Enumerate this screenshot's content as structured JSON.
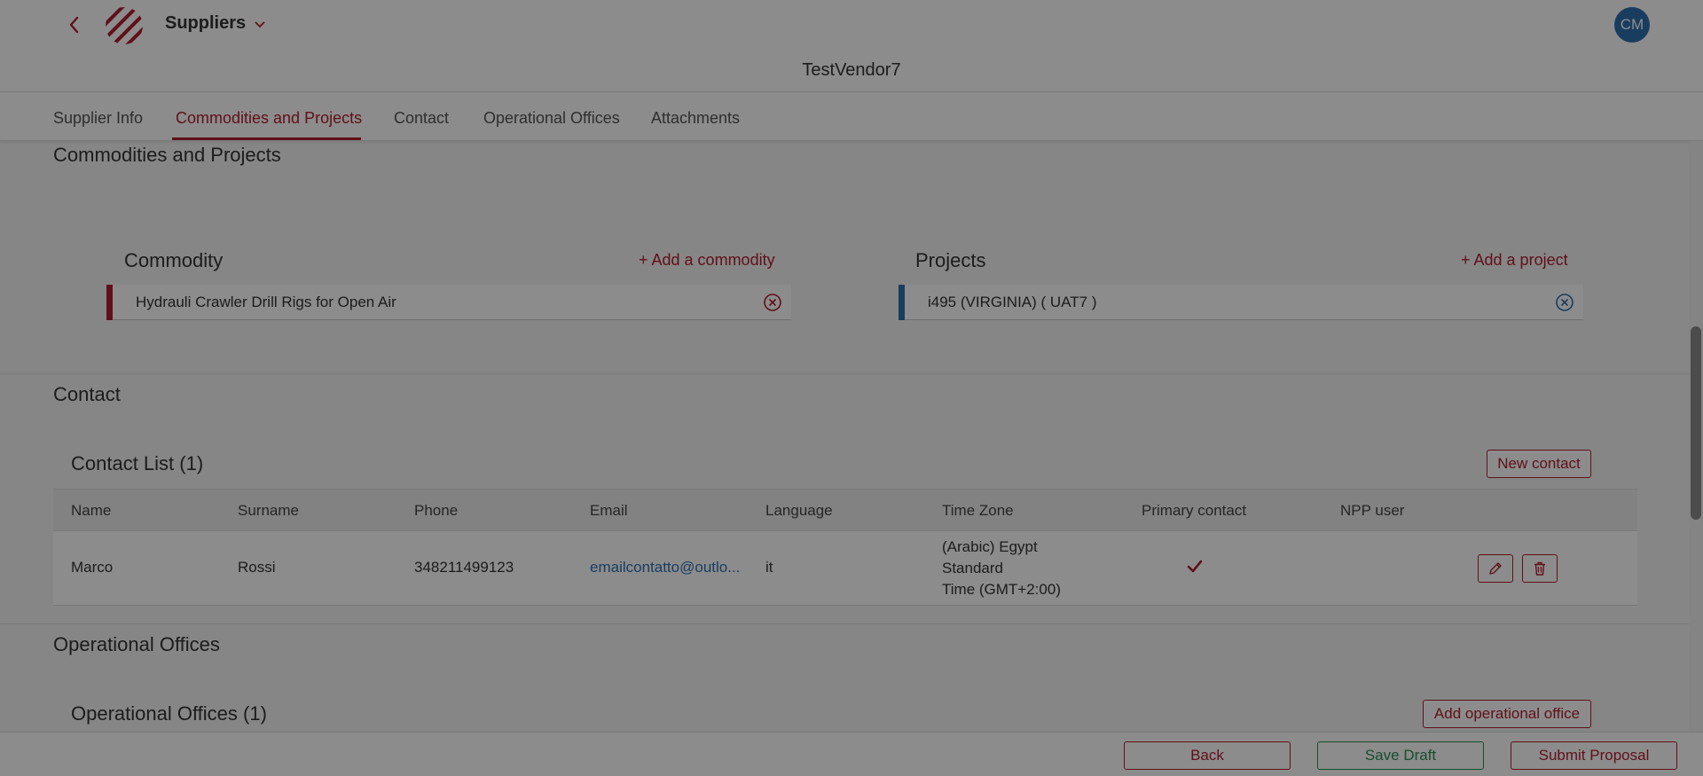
{
  "header": {
    "back_icon": "chevron-left-icon",
    "logo_icon": "striped-sphere-logo",
    "app_title": "Suppliers",
    "app_title_icon": "chevron-down-icon",
    "avatar_initials": "CM",
    "vendor_name": "TestVendor7"
  },
  "tabs": [
    {
      "label": "Supplier Info",
      "active": false
    },
    {
      "label": "Commodities and Projects",
      "active": true
    },
    {
      "label": "Contact",
      "active": false
    },
    {
      "label": "Operational Offices",
      "active": false
    },
    {
      "label": "Attachments",
      "active": false
    }
  ],
  "commodities_projects": {
    "section_title": "Commodities and Projects",
    "commodity": {
      "title": "Commodity",
      "add_label": "+ Add a commodity",
      "items": [
        "Hydrauli Crawler Drill Rigs for Open Air"
      ],
      "remove_icon": "circle-x-icon"
    },
    "projects": {
      "title": "Projects",
      "add_label": "+ Add a project",
      "items": [
        "i495 (VIRGINIA) ( UAT7 )"
      ],
      "remove_icon": "circle-x-icon"
    }
  },
  "contact": {
    "section_title": "Contact",
    "list_title": "Contact List (1)",
    "new_button": "New contact",
    "columns": [
      "Name",
      "Surname",
      "Phone",
      "Email",
      "Language",
      "Time Zone",
      "Primary contact",
      "NPP user"
    ],
    "rows": [
      {
        "name": "Marco",
        "surname": "Rossi",
        "phone": "348211499123",
        "email": "emailcontatto@outlo...",
        "language": "it",
        "time_zone": [
          "(Arabic) Egypt",
          "Standard",
          "Time (GMT+2:00)"
        ],
        "primary_contact_icon": "checkmark-icon",
        "actions": [
          "pencil-icon",
          "trash-icon"
        ]
      }
    ]
  },
  "operational_offices": {
    "section_title": "Operational Offices",
    "list_title": "Operational Offices (1)",
    "add_button": "Add operational office"
  },
  "footer": {
    "back": "Back",
    "save_draft": "Save Draft",
    "submit": "Submit Proposal"
  },
  "colors": {
    "accent": "#b01e2f",
    "link": "#2f6fae",
    "save_green": "#2e8b57",
    "overlay": "rgba(0,0,0,0.45)"
  }
}
